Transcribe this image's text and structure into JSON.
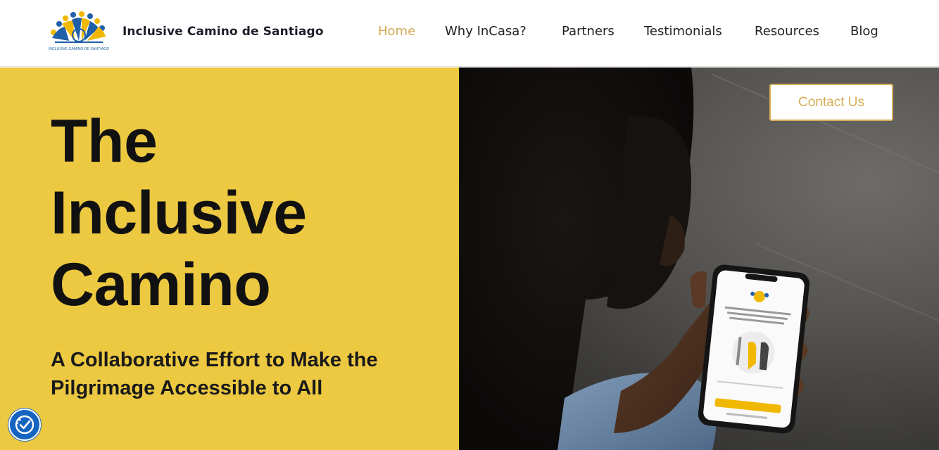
{
  "header": {
    "brand": "Inclusive Camino de Santiago",
    "logo_caption": "INCLUSIVE CAMINO DE SANTIAGO",
    "nav": [
      {
        "label": "Home",
        "active": true
      },
      {
        "label": "Why InCasa?",
        "active": false
      },
      {
        "label": "Partners",
        "active": false
      },
      {
        "label": "Testimonials",
        "active": false
      },
      {
        "label": "Resources",
        "active": false
      },
      {
        "label": "Blog",
        "active": false
      }
    ]
  },
  "hero": {
    "title_lines": [
      "The",
      "Inclusive",
      "Camino"
    ],
    "subtitle": "A Collaborative Effort to Make the Pilgrimage Accessible to All",
    "contact_label": "Contact Us"
  },
  "icons": {
    "accessibility": "accessibility-check-icon",
    "logo": "people-circle-logo-icon"
  },
  "colors": {
    "accent": "#d6ad57",
    "hero_yellow": "#edc941",
    "nav_active": "#d4aa55",
    "a11y_blue": "#1564c0"
  }
}
